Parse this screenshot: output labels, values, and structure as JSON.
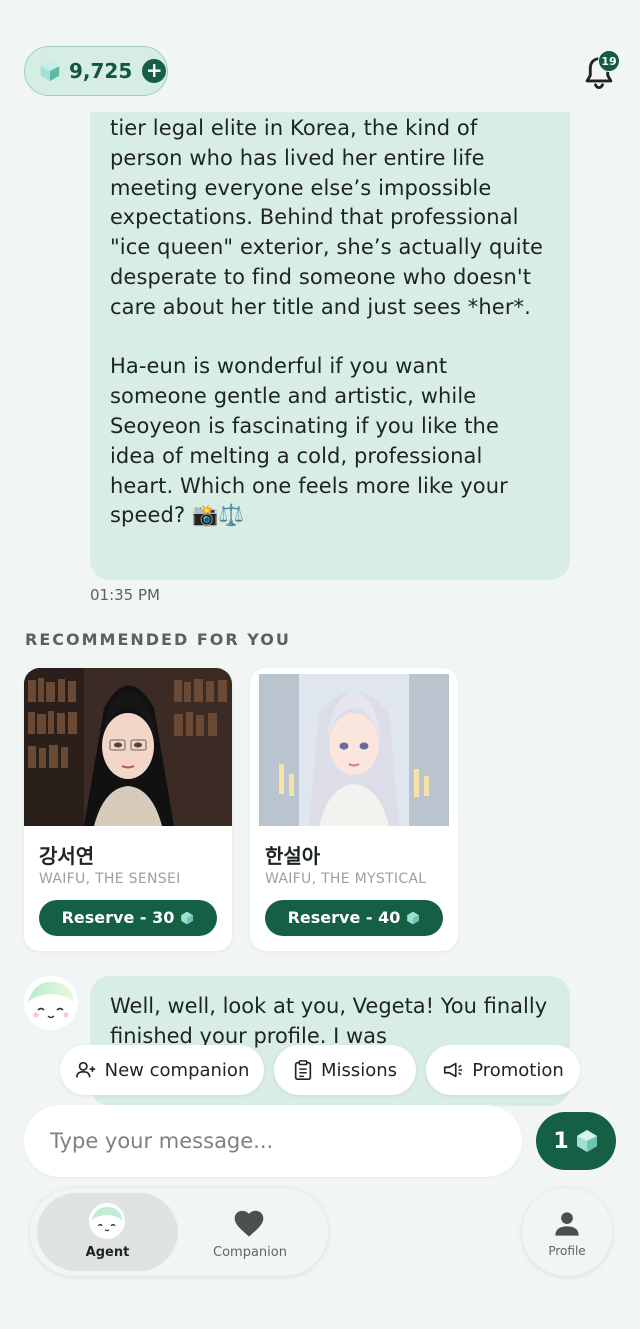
{
  "header": {
    "coin_balance": "9,725",
    "add_icon": "plus-icon",
    "gem_icon": "gem-icon",
    "notifications_icon": "bell-icon",
    "notification_count": "19"
  },
  "messages": {
    "top_text": "tier legal elite in Korea, the kind of person who has lived her entire life meeting everyone else’s impossible expectations. Behind that professional \"ice queen\" exterior, she’s actually quite desperate to find someone who doesn't care about her title and just sees *her*.\n\nHa-eun is wonderful if you want someone gentle and artistic, while Seoyeon is fascinating if you like the idea of melting a cold, professional heart. Which one feels more like your speed? 📸⚖️",
    "top_time": "01:35 PM",
    "bottom_text": "Well, well, look at you, Vegeta! You finally finished your profile. I was"
  },
  "recommended": {
    "title": "RECOMMENDED FOR YOU",
    "cards": [
      {
        "name": "강서연",
        "subtitle": "WAIFU, THE SENSEI",
        "button": "Reserve - 30"
      },
      {
        "name": "한설아",
        "subtitle": "WAIFU, THE MYSTICAL",
        "button": "Reserve - 40"
      }
    ]
  },
  "quick_actions": [
    {
      "label": "New companion",
      "icon": "add-person-icon"
    },
    {
      "label": "Missions",
      "icon": "clipboard-icon"
    },
    {
      "label": "Promotion",
      "icon": "megaphone-icon"
    }
  ],
  "composer": {
    "placeholder": "Type your message...",
    "send_cost": "1"
  },
  "nav": {
    "agent": "Agent",
    "companion": "Companion",
    "profile": "Profile"
  },
  "colors": {
    "accent": "#155f45",
    "bubble": "#d8eee5",
    "background": "#f1f6f4"
  }
}
